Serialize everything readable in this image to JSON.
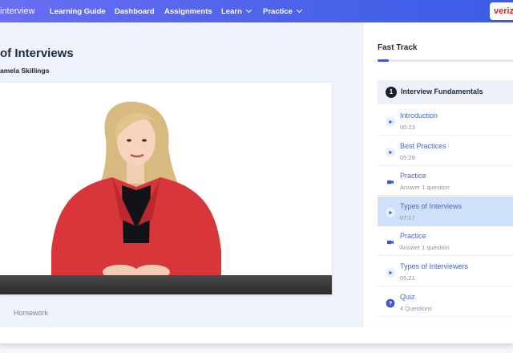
{
  "header": {
    "brand": "interview",
    "nav": [
      {
        "label": "Learning Guide"
      },
      {
        "label": "Dashboard"
      },
      {
        "label": "Assignments"
      },
      {
        "label": "Learn"
      },
      {
        "label": "Practice"
      }
    ],
    "logo_text": "veriz"
  },
  "course": {
    "title": "of Interviews",
    "author": "amela Skillings",
    "homework_tab": "Homework"
  },
  "panel": {
    "title": "Fast Track",
    "progress": 0.08,
    "section": {
      "number": "1",
      "label": "Interview Fundamentals"
    },
    "lessons": [
      {
        "title": "Introduction",
        "subtitle": "00:23",
        "icon": "play-icon"
      },
      {
        "title": "Best Practices",
        "subtitle": "05:29",
        "icon": "play-icon"
      },
      {
        "title": "Practice",
        "subtitle": "Answer 1 question",
        "icon": "camera-icon"
      },
      {
        "title": "Types of Interviews",
        "subtitle": "07:17",
        "icon": "play-icon"
      },
      {
        "title": "Practice",
        "subtitle": "Answer 1 question",
        "icon": "camera-icon"
      },
      {
        "title": "Types of Interviewers",
        "subtitle": "05:21",
        "icon": "play-icon"
      },
      {
        "title": "Quiz",
        "subtitle": "4 Questions",
        "icon": "help-icon"
      }
    ],
    "active_lesson": "Types of Interviews"
  },
  "colors": {
    "accent": "#3d56d6",
    "active_row": "#cfe1f8",
    "brand_red": "#e0241e"
  }
}
